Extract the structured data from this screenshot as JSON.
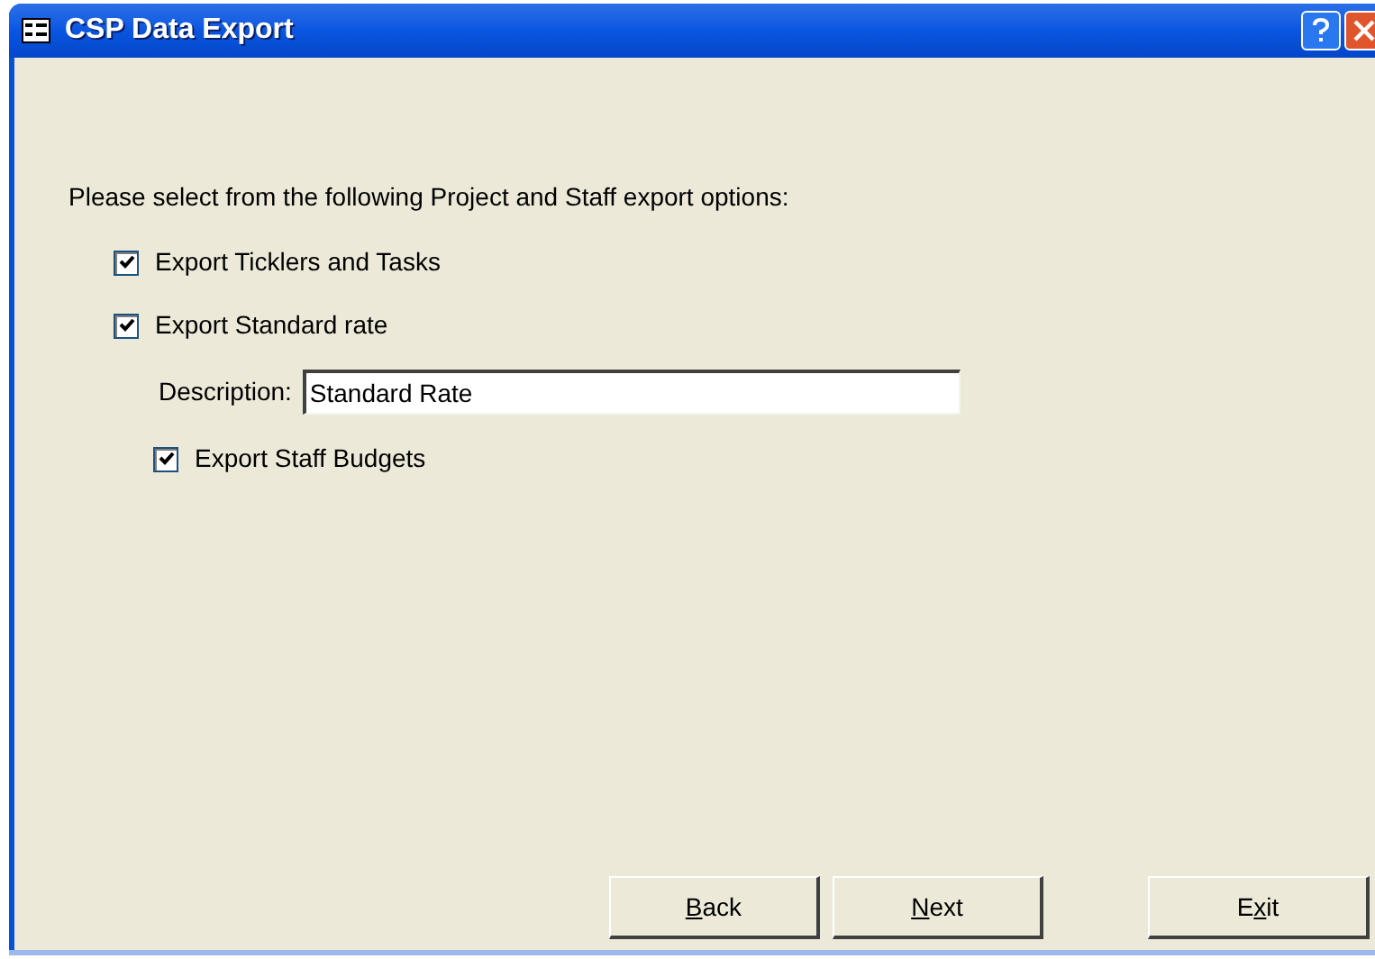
{
  "window": {
    "title": "CSP Data Export"
  },
  "prompt": "Please select from the following Project and Staff export options:",
  "items": [
    {
      "kind": "checkbox",
      "label": "Export Ticklers and Tasks",
      "checked": true
    },
    {
      "kind": "checkbox",
      "label": "Export Standard rate",
      "checked": true
    },
    {
      "kind": "field",
      "label": "Description:",
      "value": "Standard Rate"
    },
    {
      "kind": "subcheckbox",
      "label": "Export Staff Budgets",
      "checked": true
    }
  ],
  "buttons": [
    {
      "key": "B",
      "after": "ack"
    },
    {
      "key": "N",
      "after": "ext"
    },
    {
      "before": "E",
      "key": "x",
      "after": "it"
    }
  ]
}
